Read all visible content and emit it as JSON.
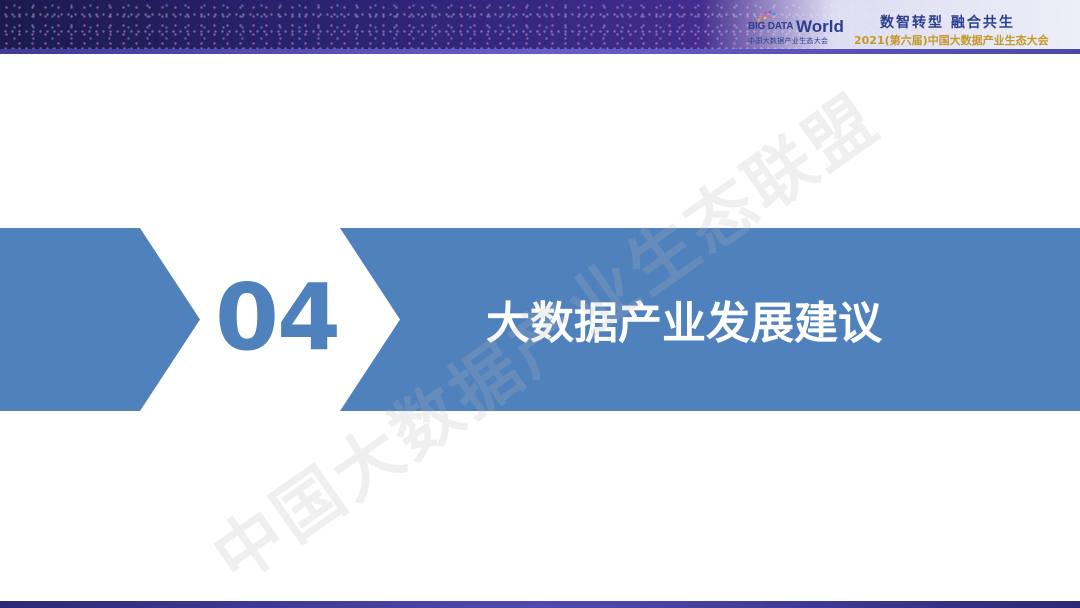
{
  "header": {
    "logo_big": "BIG DATA",
    "logo_world": "World",
    "logo_sub": "中国大数据产业生态大会",
    "slogan": "数智转型 融合共生",
    "event": "2021(第六届)中国大数据产业生态大会"
  },
  "section": {
    "number": "04",
    "title": "大数据产业发展建议"
  },
  "watermark": "中国大数据产业生态联盟",
  "colors": {
    "ribbon": "#4f81bd",
    "number": "#4f81bd",
    "title": "#ffffff",
    "slogan": "#2b3f8e",
    "event": "#c39a2a"
  }
}
